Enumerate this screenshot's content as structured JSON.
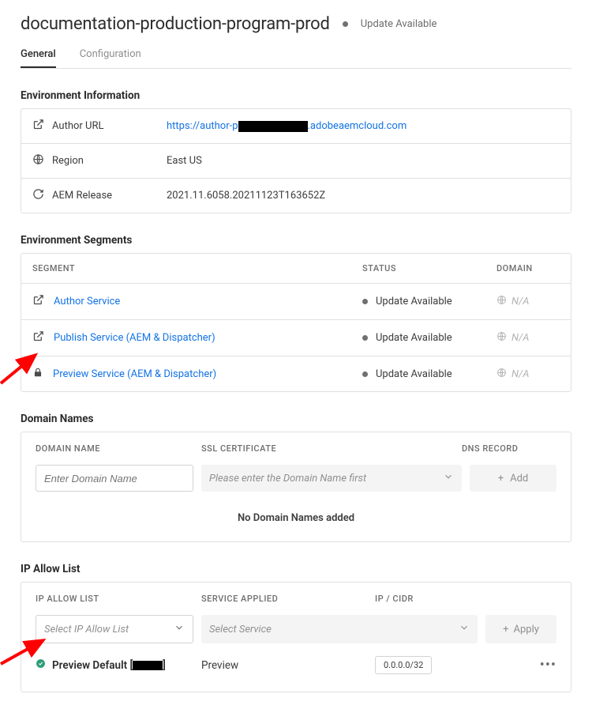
{
  "header": {
    "title": "documentation-production-program-prod",
    "status": "Update Available"
  },
  "tabs": {
    "general": "General",
    "config": "Configuration"
  },
  "env_info": {
    "section_title": "Environment Information",
    "items": [
      {
        "label": "Author URL",
        "value_prefix": "https://author-p",
        "value_suffix": ".adobeaemcloud.com",
        "is_link": true,
        "icon": "open"
      },
      {
        "label": "Region",
        "value": "East US",
        "icon": "globe"
      },
      {
        "label": "AEM Release",
        "value": "2021.11.6058.20211123T163652Z",
        "icon": "refresh"
      }
    ]
  },
  "segments": {
    "section_title": "Environment Segments",
    "head": {
      "segment": "SEGMENT",
      "status": "STATUS",
      "domain": "DOMAIN"
    },
    "rows": [
      {
        "label": "Author Service",
        "status": "Update Available",
        "domain": "N/A",
        "icon": "open"
      },
      {
        "label": "Publish Service (AEM & Dispatcher)",
        "status": "Update Available",
        "domain": "N/A",
        "icon": "open"
      },
      {
        "label": "Preview Service (AEM & Dispatcher)",
        "status": "Update Available",
        "domain": "N/A",
        "icon": "lock"
      }
    ]
  },
  "domains": {
    "section_title": "Domain Names",
    "head": {
      "name": "DOMAIN NAME",
      "ssl": "SSL CERTIFICATE",
      "dns": "DNS RECORD"
    },
    "input_placeholder": "Enter Domain Name",
    "ssl_placeholder": "Please enter the Domain Name first",
    "add_label": "Add",
    "empty_msg": "No Domain Names added"
  },
  "ip": {
    "section_title": "IP Allow List",
    "head": {
      "list": "IP ALLOW LIST",
      "service": "SERVICE APPLIED",
      "cidr": "IP / CIDR"
    },
    "select_placeholder": "Select IP Allow List",
    "service_placeholder": "Select Service",
    "apply_label": "Apply",
    "row": {
      "name_prefix": "Preview Default [",
      "name_suffix": "]",
      "service": "Preview",
      "cidr": "0.0.0.0/32"
    }
  }
}
